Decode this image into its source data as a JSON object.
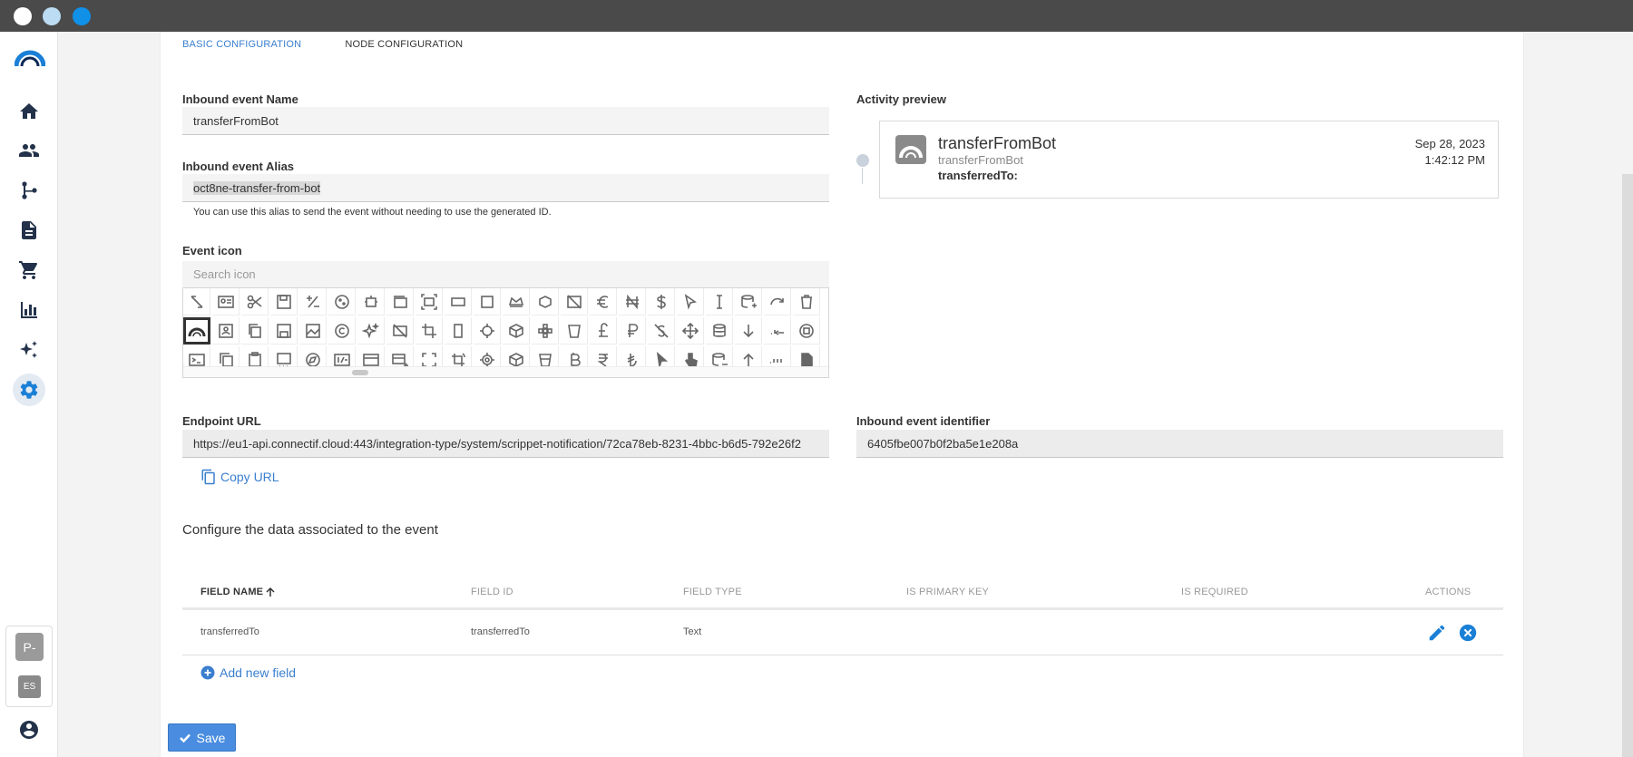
{
  "tabs": [
    {
      "label": "BASIC CONFIGURATION",
      "active": true
    },
    {
      "label": "NODE CONFIGURATION",
      "active": false
    }
  ],
  "form": {
    "name_label": "Inbound event Name",
    "name_value": "transferFromBot",
    "alias_label": "Inbound event Alias",
    "alias_value": "oct8ne-transfer-from-bot",
    "alias_hint": "You can use this alias to send the event without needing to use the generated ID.",
    "icon_label": "Event icon",
    "icon_search_placeholder": "Search icon",
    "endpoint_label": "Endpoint URL",
    "endpoint_value": "https://eu1-api.connectif.cloud:443/integration-type/system/scrippet-notification/72ca78eb-8231-4bbc-b6d5-792e26f2",
    "copy_url_label": "Copy URL",
    "identifier_label": "Inbound event identifier",
    "identifier_value": "6405fbe007b0f2ba5e1e208a"
  },
  "icon_grid": {
    "selected_icon": "custom-arch-icon",
    "icon_color": "#666666",
    "selected_border_color": "#333333"
  },
  "preview": {
    "label": "Activity preview",
    "title": "transferFromBot",
    "subtitle": "transferFromBot",
    "field_line": "transferredTo:",
    "date": "Sep 28, 2023",
    "time": "1:42:12 PM"
  },
  "data_section": {
    "title": "Configure the data associated to the event",
    "columns": [
      "FIELD NAME",
      "FIELD ID",
      "FIELD TYPE",
      "IS PRIMARY KEY",
      "IS REQUIRED",
      "ACTIONS"
    ],
    "rows": [
      {
        "field_name": "transferredTo",
        "field_id": "transferredTo",
        "field_type": "Text",
        "is_primary_key": "",
        "is_required": ""
      }
    ],
    "add_field_label": "Add new field"
  },
  "save_label": "Save",
  "user_badges": {
    "profile": "P-",
    "language": "ES"
  },
  "colors": {
    "accent": "#3a7fcf",
    "save_button": "#4a8de0",
    "titlebar": "#4a4a4a",
    "sidebar_active": "#1a7fd6",
    "delete_action": "#1a7fd6"
  }
}
